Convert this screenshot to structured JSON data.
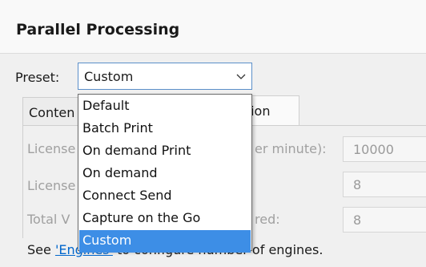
{
  "header": {
    "title": "Parallel Processing"
  },
  "preset": {
    "label": "Preset:",
    "selected": "Custom",
    "options": [
      "Default",
      "Batch Print",
      "On demand Print",
      "On demand",
      "Connect Send",
      "Capture on the Go",
      "Custom"
    ]
  },
  "tabs": [
    {
      "label": "Conten"
    },
    {
      "label": "ation"
    }
  ],
  "rows": [
    {
      "label": "License",
      "label_tail": "er minute):",
      "value": "10000"
    },
    {
      "label": "License",
      "label_tail": "",
      "value": "8"
    },
    {
      "label": "Total V",
      "label_tail": "red:",
      "value": "8"
    }
  ],
  "note": {
    "prefix": "See ",
    "link": "'Engines'",
    "suffix": " to configure number of engines."
  },
  "colors": {
    "selection": "#3d8ee6",
    "link": "#0066cc",
    "select_border": "#5b8fc9"
  }
}
